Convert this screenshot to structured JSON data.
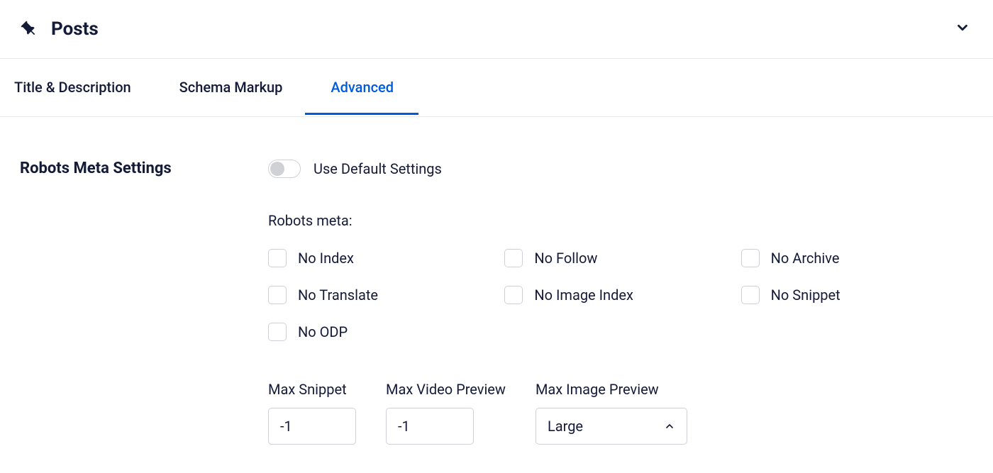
{
  "header": {
    "title": "Posts"
  },
  "tabs": [
    {
      "label": "Title & Description",
      "active": false
    },
    {
      "label": "Schema Markup",
      "active": false
    },
    {
      "label": "Advanced",
      "active": true
    }
  ],
  "section": {
    "title": "Robots Meta Settings",
    "toggle": {
      "checked": false,
      "label": "Use Default Settings"
    },
    "robots_meta_label": "Robots meta:",
    "checkboxes": [
      {
        "label": "No Index",
        "checked": false
      },
      {
        "label": "No Follow",
        "checked": false
      },
      {
        "label": "No Archive",
        "checked": false
      },
      {
        "label": "No Translate",
        "checked": false
      },
      {
        "label": "No Image Index",
        "checked": false
      },
      {
        "label": "No Snippet",
        "checked": false
      },
      {
        "label": "No ODP",
        "checked": false
      }
    ],
    "inputs": {
      "max_snippet": {
        "label": "Max Snippet",
        "value": "-1"
      },
      "max_video_preview": {
        "label": "Max Video Preview",
        "value": "-1"
      },
      "max_image_preview": {
        "label": "Max Image Preview",
        "value": "Large"
      }
    }
  }
}
